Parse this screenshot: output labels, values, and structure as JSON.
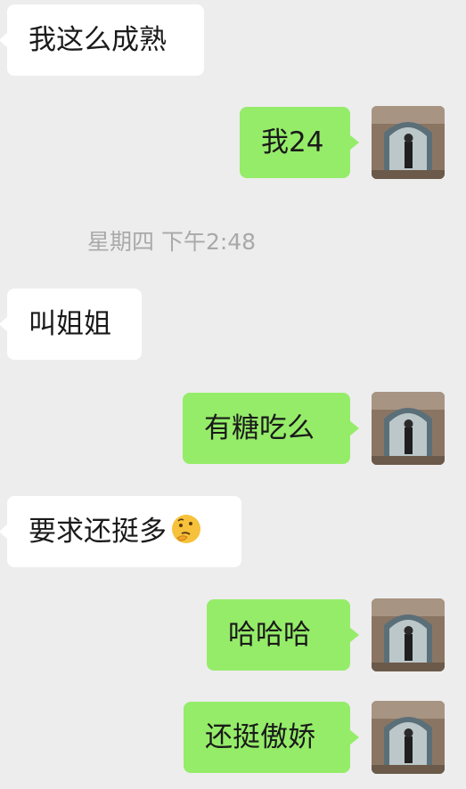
{
  "messages": [
    {
      "side": "left",
      "text": "我这么成熟"
    },
    {
      "side": "right",
      "text": "我24"
    },
    {
      "side": "left",
      "text": "叫姐姐"
    },
    {
      "side": "right",
      "text": "有糖吃么"
    },
    {
      "side": "left",
      "text": "要求还挺多",
      "emoji": "thinking-face-emoji"
    },
    {
      "side": "right",
      "text": "哈哈哈"
    },
    {
      "side": "right",
      "text": "还挺傲娇"
    }
  ],
  "timestamp": "星期四 下午2:48",
  "colors": {
    "background": "#ededed",
    "incoming_bubble": "#ffffff",
    "outgoing_bubble": "#95ec69",
    "timestamp_text": "#a9a9a9"
  }
}
